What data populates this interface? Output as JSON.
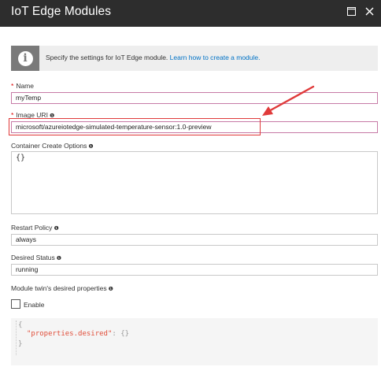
{
  "header": {
    "title": "IoT Edge Modules"
  },
  "info": {
    "text": "Specify the settings for IoT Edge module.",
    "link": "Learn how to create a module."
  },
  "name_field": {
    "label": "Name",
    "value": "myTemp"
  },
  "image_uri": {
    "label": "Image URI",
    "value": "microsoft/azureiotedge-simulated-temperature-sensor:1.0-preview"
  },
  "container_options": {
    "label": "Container Create Options",
    "value": "{}"
  },
  "restart_policy": {
    "label": "Restart Policy",
    "value": "always"
  },
  "desired_status": {
    "label": "Desired Status",
    "value": "running"
  },
  "twin": {
    "label": "Module twin's desired properties",
    "enable_label": "Enable",
    "enabled": false
  },
  "editor": {
    "open": "{",
    "key": "\"properties.desired\"",
    "rest": ": {}",
    "close": "}"
  },
  "colors": {
    "header_bg": "#2d2d2d",
    "link": "#0072c6",
    "required": "#dd0000",
    "annotation": "#e03a3a"
  },
  "icons": [
    "maximize-icon",
    "close-icon",
    "info-icon",
    "arrow-annotation"
  ]
}
